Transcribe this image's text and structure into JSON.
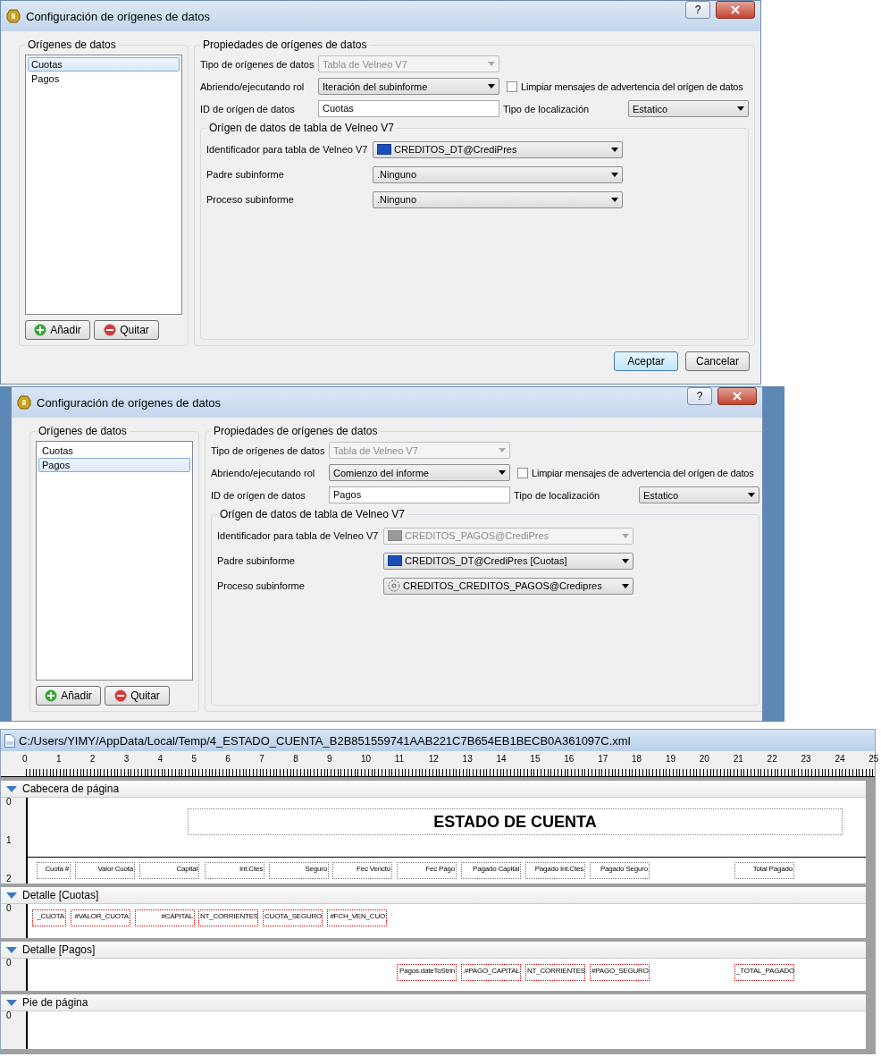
{
  "dialogs": [
    {
      "title": "Configuración de orígenes de datos",
      "help": "?",
      "sources_group": "Orígenes de datos",
      "sources": [
        {
          "label": "Cuotas",
          "selected": true
        },
        {
          "label": "Pagos",
          "selected": false
        }
      ],
      "source_buttons": [
        {
          "label": "Añadir",
          "kind": "add"
        },
        {
          "label": "Quitar",
          "kind": "remove"
        }
      ],
      "properties": {
        "title": "Propiedades de orígenes de datos",
        "type": {
          "label": "Tipo de orígenes de datos",
          "value": "Tabla de Velneo V7",
          "disabled": true
        },
        "role": {
          "label": "Abriendo/ejecutando rol",
          "value": "Iteración del subinforme",
          "disabled": false
        },
        "clear_warnings": {
          "label": "Limpiar mensajes de advertencia del orígen de datos",
          "checked": false
        },
        "id": {
          "label": "ID de orígen de datos",
          "value": "Cuotas"
        },
        "location": {
          "label": "Tipo de localización",
          "value": "Estatico",
          "disabled": false
        }
      },
      "table_source": {
        "title": "Orígen de datos de tabla de Velneo V7",
        "rows": [
          {
            "label": "Identificador para tabla de Velneo V7",
            "value": "CREDITOS_DT@CrediPres",
            "kind": "table",
            "disabled": false
          },
          {
            "label": "Padre subinforme",
            "value": ".Ninguno",
            "kind": "plain",
            "disabled": false
          },
          {
            "label": "Proceso subinforme",
            "value": ".Ninguno",
            "kind": "plain",
            "disabled": false
          }
        ]
      },
      "buttons": [
        {
          "label": "Aceptar",
          "default": true
        },
        {
          "label": "Cancelar",
          "default": false
        }
      ]
    },
    {
      "title": "Configuración de orígenes de datos",
      "help": "?",
      "sources_group": "Orígenes de datos",
      "sources": [
        {
          "label": "Cuotas",
          "selected": false
        },
        {
          "label": "Pagos",
          "selected": true
        }
      ],
      "source_buttons": [
        {
          "label": "Añadir",
          "kind": "add"
        },
        {
          "label": "Quitar",
          "kind": "remove"
        }
      ],
      "properties": {
        "title": "Propiedades de orígenes de datos",
        "type": {
          "label": "Tipo de orígenes de datos",
          "value": "Tabla de Velneo V7",
          "disabled": true
        },
        "role": {
          "label": "Abriendo/ejecutando rol",
          "value": "Comienzo del informe",
          "disabled": false
        },
        "clear_warnings": {
          "label": "Limpiar mensajes de advertencia del orígen de datos",
          "checked": false
        },
        "id": {
          "label": "ID de orígen de datos",
          "value": "Pagos"
        },
        "location": {
          "label": "Tipo de localización",
          "value": "Estatico",
          "disabled": false
        }
      },
      "table_source": {
        "title": "Orígen de datos de tabla de Velneo V7",
        "rows": [
          {
            "label": "Identificador para tabla de Velneo V7",
            "value": "CREDITOS_PAGOS@CrediPres",
            "kind": "table",
            "disabled": true
          },
          {
            "label": "Padre subinforme",
            "value": "CREDITOS_DT@CrediPres [Cuotas]",
            "kind": "table",
            "disabled": false
          },
          {
            "label": "Proceso subinforme",
            "value": "CREDITOS_CREDITOS_PAGOS@Credipres",
            "kind": "process",
            "disabled": false
          }
        ]
      }
    }
  ],
  "designer": {
    "path": "C:/Users/YIMY/AppData/Local/Temp/4_ESTADO_CUENTA_B2B851559741AAB221C7B654EB1BECB0A361097C.xml",
    "ruler": [
      "0",
      "1",
      "2",
      "3",
      "4",
      "5",
      "6",
      "7",
      "8",
      "9",
      "10",
      "11",
      "12",
      "13",
      "14",
      "15",
      "16",
      "17",
      "18",
      "19",
      "20",
      "21",
      "22",
      "23",
      "24",
      "25"
    ],
    "bands": [
      {
        "title": "Cabecera de página",
        "kind": "header",
        "ruler": [
          "0",
          "1",
          "2"
        ],
        "heading": "ESTADO DE CUENTA",
        "fields": [
          "Cuota #",
          "Valor Cuota",
          "Capital",
          "Int.Ctes",
          "Seguro",
          "Fec Vencto",
          "Fec Pago",
          "Pagado Capital",
          "Pagado Int.Ctes",
          "Pagado Seguro",
          "Total Pagado"
        ]
      },
      {
        "title": "Detalle [Cuotas]",
        "kind": "detail",
        "ruler": [
          "0"
        ],
        "fields": [
          "_CUOTA",
          "#VALOR_CUOTA",
          "#CAPITAL",
          "NT_CORRIENTES",
          "CUOTA_SEGURO",
          "#FCH_VEN_CUO"
        ]
      },
      {
        "title": "Detalle [Pagos]",
        "kind": "detail",
        "ruler": [
          "0"
        ],
        "fields": [
          "Pagos.dateToStrin",
          ".#PAGO_CAPITAL",
          "NT_CORRIENTES",
          "#PAGO_SEGURO",
          "_TOTAL_PAGADO"
        ]
      },
      {
        "title": "Pie de página",
        "kind": "footer",
        "ruler": [
          "0"
        ]
      }
    ]
  }
}
